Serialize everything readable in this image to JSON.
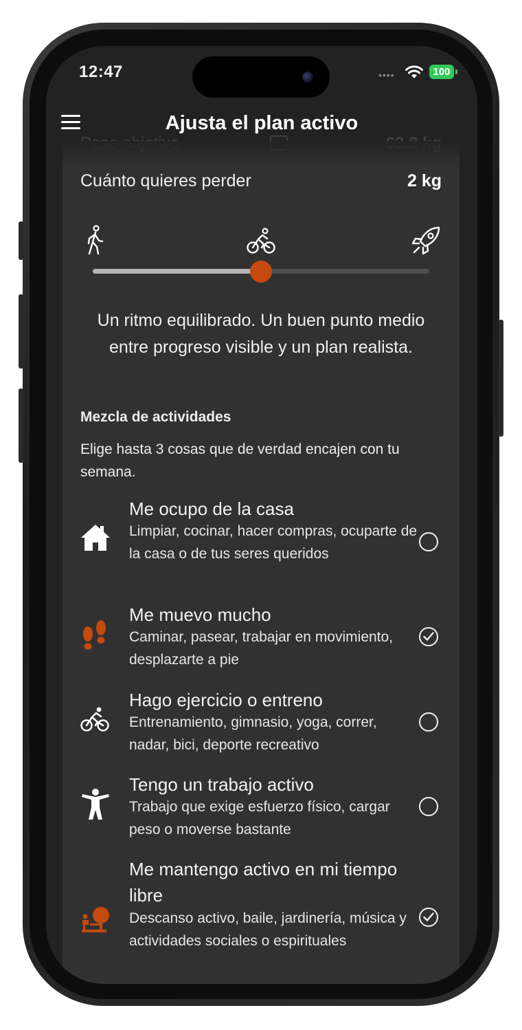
{
  "status_bar": {
    "time": "12:47",
    "battery": "100"
  },
  "header": {
    "title": "Ajusta el plan activo"
  },
  "goal_weight": {
    "label": "Peso objetivo",
    "value": "63.8 kg"
  },
  "loss": {
    "label": "Cuánto quieres perder",
    "value": "2 kg"
  },
  "pace": {
    "icons": [
      "walking-icon",
      "bicycle-icon",
      "rocket-icon"
    ],
    "slider_value_fraction": 0.5,
    "description": "Un ritmo equilibrado. Un buen punto medio entre progreso visible y un plan realista."
  },
  "activities_section": {
    "title": "Mezcla de actividades",
    "subtitle": "Elige hasta 3 cosas que de verdad encajen con tu semana."
  },
  "activities": [
    {
      "title": "Me ocupo de la casa",
      "description": "Limpiar, cocinar, hacer compras, ocuparte de la casa o de tus seres queridos",
      "icon": "house-icon",
      "selected": false
    },
    {
      "title": "Me muevo mucho",
      "description": "Caminar, pasear, trabajar en movimiento, desplazarte a pie",
      "icon": "footprints-icon",
      "selected": true
    },
    {
      "title": "Hago ejercicio o entreno",
      "description": "Entrenamiento, gimnasio, yoga, correr, nadar, bici, deporte recreativo",
      "icon": "cyclist-icon",
      "selected": false
    },
    {
      "title": "Tengo un trabajo activo",
      "description": "Trabajo que exige esfuerzo físico, cargar peso o moverse bastante",
      "icon": "person-arms-out-icon",
      "selected": false
    },
    {
      "title": "Me mantengo activo en mi tiempo libre",
      "description": "Descanso activo, baile, jardinería, música y actividades sociales o espirituales",
      "icon": "leisure-icon",
      "selected": true
    }
  ],
  "colors": {
    "accent": "#c54a0e",
    "background": "#222222",
    "card": "#313131",
    "text": "#f2f2f2"
  }
}
